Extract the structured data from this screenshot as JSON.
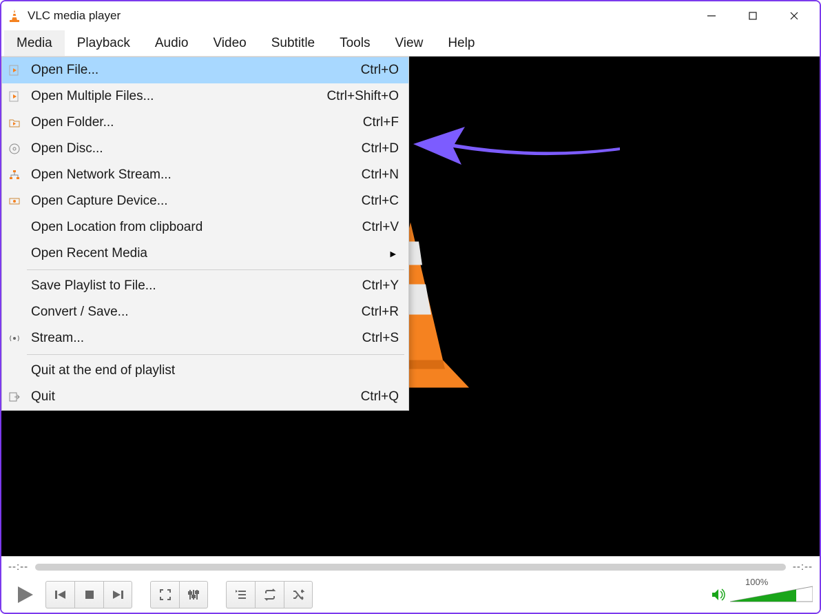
{
  "window": {
    "title": "VLC media player"
  },
  "menubar": {
    "items": [
      "Media",
      "Playback",
      "Audio",
      "Video",
      "Subtitle",
      "Tools",
      "View",
      "Help"
    ],
    "active_index": 0
  },
  "dropdown": {
    "groups": [
      [
        {
          "label": "Open File...",
          "shortcut": "Ctrl+O",
          "icon": "file-play",
          "highlight": true
        },
        {
          "label": "Open Multiple Files...",
          "shortcut": "Ctrl+Shift+O",
          "icon": "file-play"
        },
        {
          "label": "Open Folder...",
          "shortcut": "Ctrl+F",
          "icon": "folder-play"
        },
        {
          "label": "Open Disc...",
          "shortcut": "Ctrl+D",
          "icon": "disc"
        },
        {
          "label": "Open Network Stream...",
          "shortcut": "Ctrl+N",
          "icon": "network"
        },
        {
          "label": "Open Capture Device...",
          "shortcut": "Ctrl+C",
          "icon": "capture"
        },
        {
          "label": "Open Location from clipboard",
          "shortcut": "Ctrl+V",
          "icon": ""
        },
        {
          "label": "Open Recent Media",
          "shortcut": "",
          "icon": "",
          "submenu": true
        }
      ],
      [
        {
          "label": "Save Playlist to File...",
          "shortcut": "Ctrl+Y",
          "icon": ""
        },
        {
          "label": "Convert / Save...",
          "shortcut": "Ctrl+R",
          "icon": ""
        },
        {
          "label": "Stream...",
          "shortcut": "Ctrl+S",
          "icon": "stream"
        }
      ],
      [
        {
          "label": "Quit at the end of playlist",
          "shortcut": "",
          "icon": ""
        },
        {
          "label": "Quit",
          "shortcut": "Ctrl+Q",
          "icon": "quit"
        }
      ]
    ]
  },
  "player": {
    "time_elapsed": "--:--",
    "time_total": "--:--",
    "volume_label": "100%"
  },
  "colors": {
    "highlight": "#a8d8ff",
    "accent_orange": "#f58220",
    "annotation_purple": "#7c5cff",
    "volume_green": "#1aa51a"
  }
}
